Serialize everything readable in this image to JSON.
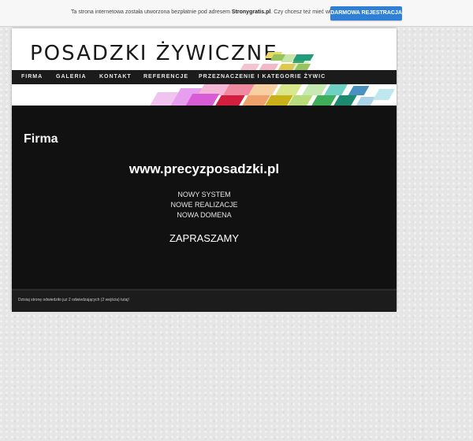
{
  "promo_bar": {
    "text_before": "Ta strona internetowa została utworzona bezpłatnie pod adresem ",
    "brand": "Stronygratis.pl",
    "text_after": ". Czy chcesz też mieć własną stronę?",
    "button_label": "DARMOWA REJESTRACJA"
  },
  "site": {
    "title": "POSADZKI ŻYWICZNE",
    "nav": [
      {
        "label": "FIRMA"
      },
      {
        "label": "GALERIA"
      },
      {
        "label": "KONTAKT"
      },
      {
        "label": "REFERENCJE"
      },
      {
        "label": "PRZEZNACZENIE I KATEGORIE ŻYWIC"
      }
    ]
  },
  "content": {
    "page_title": "Firma",
    "url": "www.precyzposadzki.pl",
    "lines": [
      "NOWY SYSTEM",
      "NOWE REALIZACJE",
      "NOWA DOMENA"
    ],
    "invite": "ZAPRASZAMY"
  },
  "footer": {
    "visits_text": "Dzisiaj stronę odwiedziło już 2 odwiedzających (2 wejścia) tutaj!"
  },
  "colors": {
    "button": "#2f7fd6",
    "header_bg": "#ffffff",
    "nav_bg": "#1b1b1b",
    "content_bg": "#111111"
  }
}
